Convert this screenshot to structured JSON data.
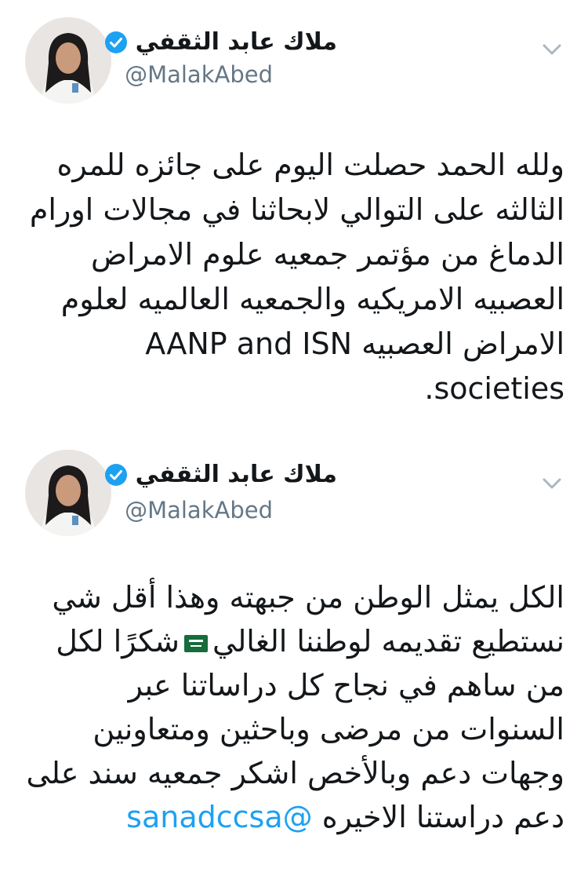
{
  "tweets": [
    {
      "author": {
        "display_name": "ملاك عابد الثقفي",
        "handle": "@MalakAbed",
        "verified": true
      },
      "text_lines": [
        "ولله الحمد حصلت اليوم على جائزه للمره",
        "الثالثه على التوالي لابحاثنا في مجالات اورام",
        "الدماغ من مؤتمر جمعيه  علوم الامراض",
        "العصبيه الامريكيه والجمعيه العالميه لعلوم",
        "الامراض العصبيه AANP and ISN",
        "societies."
      ]
    },
    {
      "author": {
        "display_name": "ملاك عابد الثقفي",
        "handle": "@MalakAbed",
        "verified": true
      },
      "text_lines": [
        "الكل يمثل الوطن من جبهته وهذا أقل شي",
        "شكرًا لكل",
        "نستطيع تقديمه لوطننا الغالي",
        "من ساهم في نجاح كل دراساتنا عبر",
        "السنوات من مرضى وباحثين ومتعاونين",
        "وجهات دعم وبالأخص اشكر جمعيه سند على",
        "دعم دراستنا الاخيره",
        "@sanadccsa"
      ],
      "flag_icon": "saudi-flag-icon"
    }
  ],
  "colors": {
    "mention": "#1da1f2",
    "handle": "#657786",
    "verified": "#1da1f2"
  }
}
